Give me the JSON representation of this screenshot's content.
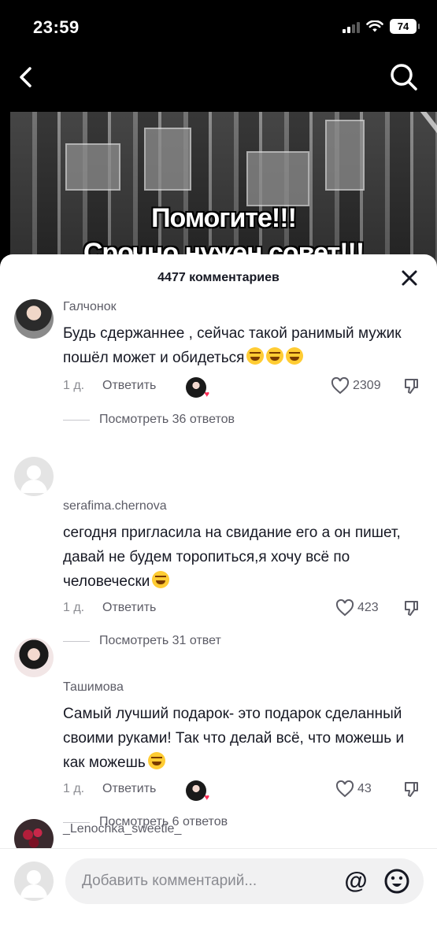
{
  "status_bar": {
    "time": "23:59",
    "battery": "74"
  },
  "nav": {
    "back_icon": "chevron-left-icon",
    "search_icon": "search-icon"
  },
  "video": {
    "overlay_line1": "Помогите!!!",
    "overlay_line2": "Срочно нужен совет!!!"
  },
  "sheet": {
    "title": "4477 комментариев",
    "close_icon": "close-icon"
  },
  "comments": [
    {
      "username": "Галчонок",
      "text": "Будь сдержаннее , сейчас такой ранимый мужик пошёл может и обидеться",
      "emoji_count": 3,
      "age": "1 д.",
      "reply_label": "Ответить",
      "liked_by_creator": true,
      "likes": "2309",
      "replies_label": "Посмотреть 36 ответов"
    },
    {
      "username": "serafima.chernova",
      "text": "сегодня пригласила на свидание его а он пишет, давай не будем торопиться,я хочу всё по человечески",
      "emoji_count": 1,
      "age": "1 д.",
      "reply_label": "Ответить",
      "liked_by_creator": false,
      "likes": "423",
      "replies_label": "Посмотреть 31 ответ"
    },
    {
      "username": "Ташимова",
      "text": "Самый лучший подарок- это подарок сделанный своими руками! Так что делай всё, что можешь и как можешь",
      "emoji_count": 1,
      "age": "1 д.",
      "reply_label": "Ответить",
      "liked_by_creator": true,
      "likes": "43",
      "replies_label": "Посмотреть 6 ответов"
    },
    {
      "username": "_Lenochka_sweetie_"
    }
  ],
  "input": {
    "placeholder": "Добавить комментарий...",
    "mention_symbol": "@",
    "emoji_icon": "emoji-icon"
  },
  "colors": {
    "accent_red": "#fe2c55",
    "text_primary": "#161823",
    "text_secondary": "#8a8b91"
  }
}
